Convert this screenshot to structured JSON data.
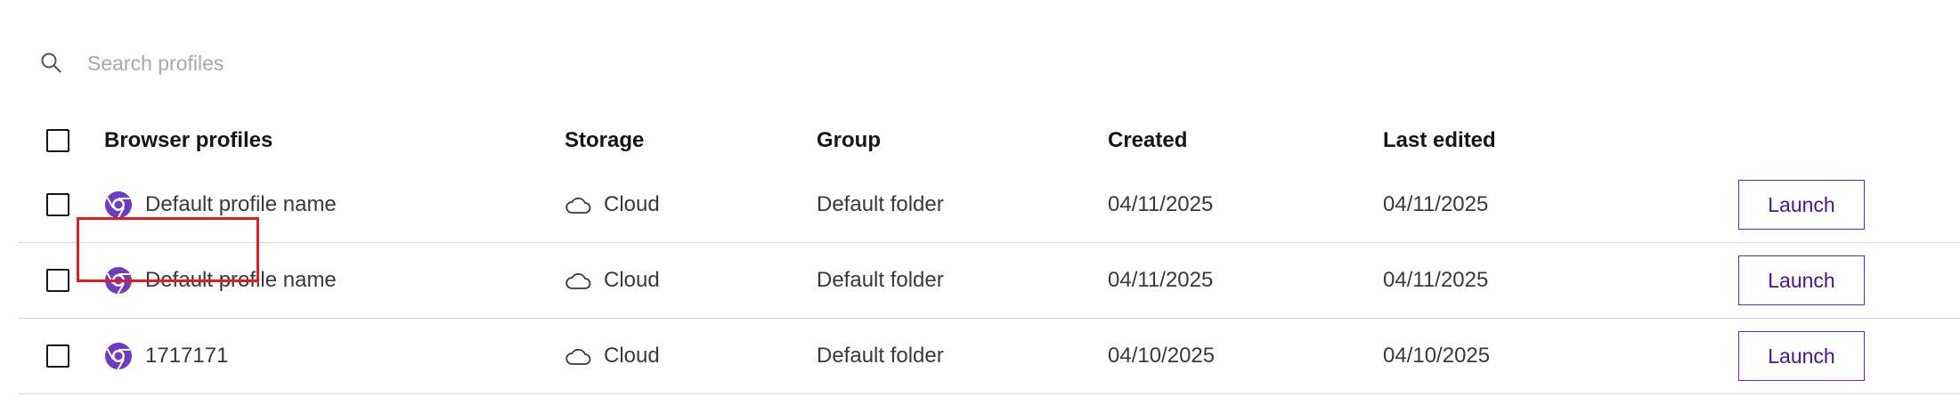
{
  "search": {
    "placeholder": "Search profiles",
    "value": ""
  },
  "table": {
    "headers": {
      "name": "Browser profiles",
      "storage": "Storage",
      "group": "Group",
      "created": "Created",
      "edited": "Last edited"
    },
    "rows": [
      {
        "name": "Default profile name",
        "storage": "Cloud",
        "group": "Default folder",
        "created": "04/11/2025",
        "edited": "04/11/2025",
        "action": "Launch",
        "checked": false
      },
      {
        "name": "Default profile name",
        "storage": "Cloud",
        "group": "Default folder",
        "created": "04/11/2025",
        "edited": "04/11/2025",
        "action": "Launch",
        "checked": false
      },
      {
        "name": "1717171",
        "storage": "Cloud",
        "group": "Default folder",
        "created": "04/10/2025",
        "edited": "04/10/2025",
        "action": "Launch",
        "checked": false
      }
    ]
  },
  "icons": {
    "search": "search-icon",
    "browser": "chrome-icon",
    "storage": "cloud-icon"
  },
  "colors": {
    "accent": "#6929c4",
    "highlight": "#e21d1d",
    "divider": "#d9d9d9"
  }
}
